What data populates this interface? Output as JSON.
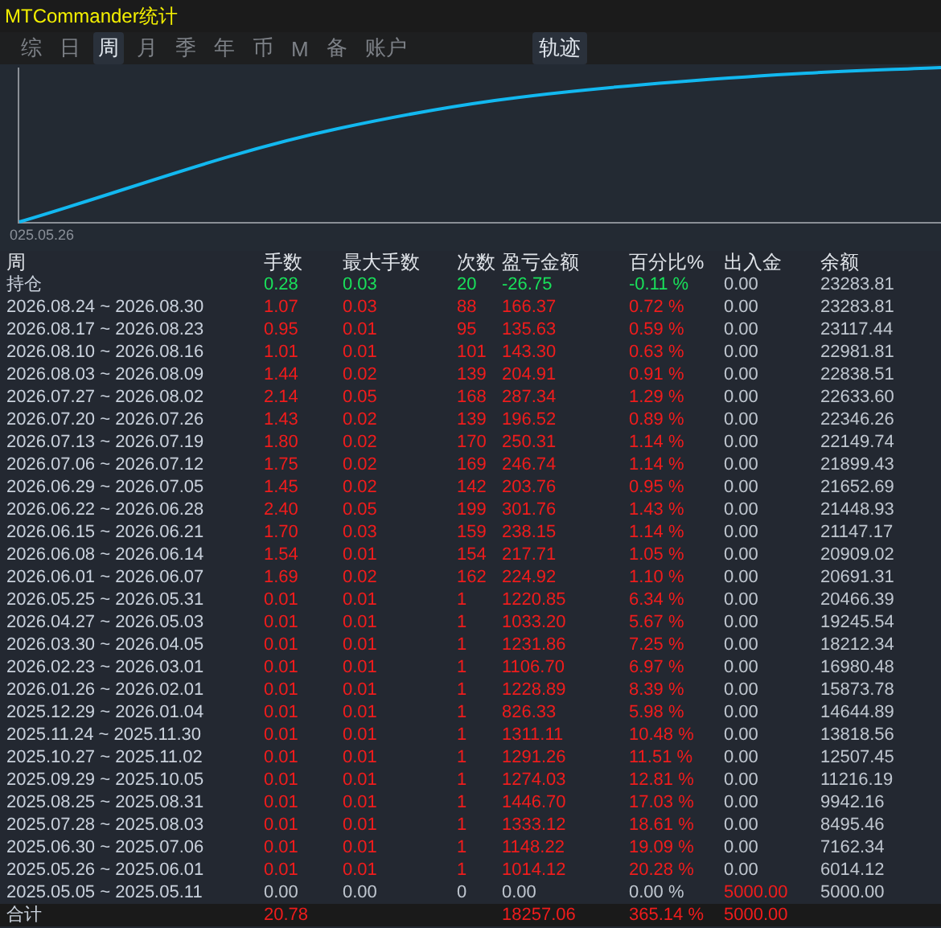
{
  "window": {
    "title": "MTCommander统计"
  },
  "tabs": [
    {
      "label": "综",
      "selected": false
    },
    {
      "label": "日",
      "selected": false
    },
    {
      "label": "周",
      "selected": true
    },
    {
      "label": "月",
      "selected": false
    },
    {
      "label": "季",
      "selected": false
    },
    {
      "label": "年",
      "selected": false
    },
    {
      "label": "币",
      "selected": false
    },
    {
      "label": "M",
      "selected": false
    },
    {
      "label": "备",
      "selected": false
    },
    {
      "label": "账户",
      "selected": false
    }
  ],
  "track_button": {
    "label": "轨迹"
  },
  "chart": {
    "x_start_label": "025.05.26"
  },
  "table": {
    "columns": [
      "周",
      "手数",
      "最大手数",
      "次数",
      "盈亏金额",
      "百分比%",
      "出入金",
      "余额"
    ],
    "rows": [
      {
        "kind": "open",
        "cells": [
          "持仓",
          "0.28",
          "0.03",
          "20",
          "-26.75",
          "-0.11 %",
          "0.00",
          "23283.81"
        ]
      },
      {
        "kind": "profit",
        "cells": [
          "2026.08.24 ~ 2026.08.30",
          "1.07",
          "0.03",
          "88",
          "166.37",
          "0.72 %",
          "0.00",
          "23283.81"
        ]
      },
      {
        "kind": "profit",
        "cells": [
          "2026.08.17 ~ 2026.08.23",
          "0.95",
          "0.01",
          "95",
          "135.63",
          "0.59 %",
          "0.00",
          "23117.44"
        ]
      },
      {
        "kind": "profit",
        "cells": [
          "2026.08.10 ~ 2026.08.16",
          "1.01",
          "0.01",
          "101",
          "143.30",
          "0.63 %",
          "0.00",
          "22981.81"
        ]
      },
      {
        "kind": "profit",
        "cells": [
          "2026.08.03 ~ 2026.08.09",
          "1.44",
          "0.02",
          "139",
          "204.91",
          "0.91 %",
          "0.00",
          "22838.51"
        ]
      },
      {
        "kind": "profit",
        "cells": [
          "2026.07.27 ~ 2026.08.02",
          "2.14",
          "0.05",
          "168",
          "287.34",
          "1.29 %",
          "0.00",
          "22633.60"
        ]
      },
      {
        "kind": "profit",
        "cells": [
          "2026.07.20 ~ 2026.07.26",
          "1.43",
          "0.02",
          "139",
          "196.52",
          "0.89 %",
          "0.00",
          "22346.26"
        ]
      },
      {
        "kind": "profit",
        "cells": [
          "2026.07.13 ~ 2026.07.19",
          "1.80",
          "0.02",
          "170",
          "250.31",
          "1.14 %",
          "0.00",
          "22149.74"
        ]
      },
      {
        "kind": "profit",
        "cells": [
          "2026.07.06 ~ 2026.07.12",
          "1.75",
          "0.02",
          "169",
          "246.74",
          "1.14 %",
          "0.00",
          "21899.43"
        ]
      },
      {
        "kind": "profit",
        "cells": [
          "2026.06.29 ~ 2026.07.05",
          "1.45",
          "0.02",
          "142",
          "203.76",
          "0.95 %",
          "0.00",
          "21652.69"
        ]
      },
      {
        "kind": "profit",
        "cells": [
          "2026.06.22 ~ 2026.06.28",
          "2.40",
          "0.05",
          "199",
          "301.76",
          "1.43 %",
          "0.00",
          "21448.93"
        ]
      },
      {
        "kind": "profit",
        "cells": [
          "2026.06.15 ~ 2026.06.21",
          "1.70",
          "0.03",
          "159",
          "238.15",
          "1.14 %",
          "0.00",
          "21147.17"
        ]
      },
      {
        "kind": "profit",
        "cells": [
          "2026.06.08 ~ 2026.06.14",
          "1.54",
          "0.01",
          "154",
          "217.71",
          "1.05 %",
          "0.00",
          "20909.02"
        ]
      },
      {
        "kind": "profit",
        "cells": [
          "2026.06.01 ~ 2026.06.07",
          "1.69",
          "0.02",
          "162",
          "224.92",
          "1.10 %",
          "0.00",
          "20691.31"
        ]
      },
      {
        "kind": "profit",
        "cells": [
          "2026.05.25 ~ 2026.05.31",
          "0.01",
          "0.01",
          "1",
          "1220.85",
          "6.34 %",
          "0.00",
          "20466.39"
        ]
      },
      {
        "kind": "profit",
        "cells": [
          "2026.04.27 ~ 2026.05.03",
          "0.01",
          "0.01",
          "1",
          "1033.20",
          "5.67 %",
          "0.00",
          "19245.54"
        ]
      },
      {
        "kind": "profit",
        "cells": [
          "2026.03.30 ~ 2026.04.05",
          "0.01",
          "0.01",
          "1",
          "1231.86",
          "7.25 %",
          "0.00",
          "18212.34"
        ]
      },
      {
        "kind": "profit",
        "cells": [
          "2026.02.23 ~ 2026.03.01",
          "0.01",
          "0.01",
          "1",
          "1106.70",
          "6.97 %",
          "0.00",
          "16980.48"
        ]
      },
      {
        "kind": "profit",
        "cells": [
          "2026.01.26 ~ 2026.02.01",
          "0.01",
          "0.01",
          "1",
          "1228.89",
          "8.39 %",
          "0.00",
          "15873.78"
        ]
      },
      {
        "kind": "profit",
        "cells": [
          "2025.12.29 ~ 2026.01.04",
          "0.01",
          "0.01",
          "1",
          "826.33",
          "5.98 %",
          "0.00",
          "14644.89"
        ]
      },
      {
        "kind": "profit",
        "cells": [
          "2025.11.24 ~ 2025.11.30",
          "0.01",
          "0.01",
          "1",
          "1311.11",
          "10.48 %",
          "0.00",
          "13818.56"
        ]
      },
      {
        "kind": "profit",
        "cells": [
          "2025.10.27 ~ 2025.11.02",
          "0.01",
          "0.01",
          "1",
          "1291.26",
          "11.51 %",
          "0.00",
          "12507.45"
        ]
      },
      {
        "kind": "profit",
        "cells": [
          "2025.09.29 ~ 2025.10.05",
          "0.01",
          "0.01",
          "1",
          "1274.03",
          "12.81 %",
          "0.00",
          "11216.19"
        ]
      },
      {
        "kind": "profit",
        "cells": [
          "2025.08.25 ~ 2025.08.31",
          "0.01",
          "0.01",
          "1",
          "1446.70",
          "17.03 %",
          "0.00",
          "9942.16"
        ]
      },
      {
        "kind": "profit",
        "cells": [
          "2025.07.28 ~ 2025.08.03",
          "0.01",
          "0.01",
          "1",
          "1333.12",
          "18.61 %",
          "0.00",
          "8495.46"
        ]
      },
      {
        "kind": "profit",
        "cells": [
          "2025.06.30 ~ 2025.07.06",
          "0.01",
          "0.01",
          "1",
          "1148.22",
          "19.09 %",
          "0.00",
          "7162.34"
        ]
      },
      {
        "kind": "profit",
        "cells": [
          "2025.05.26 ~ 2025.06.01",
          "0.01",
          "0.01",
          "1",
          "1014.12",
          "20.28 %",
          "0.00",
          "6014.12"
        ]
      },
      {
        "kind": "deposit",
        "cells": [
          "2025.05.05 ~ 2025.05.11",
          "0.00",
          "0.00",
          "0",
          "0.00",
          "0.00 %",
          "5000.00",
          "5000.00"
        ]
      }
    ],
    "total": {
      "cells": [
        "合计",
        "20.78",
        "",
        "",
        "18257.06",
        "365.14 %",
        "5000.00",
        ""
      ]
    }
  }
}
